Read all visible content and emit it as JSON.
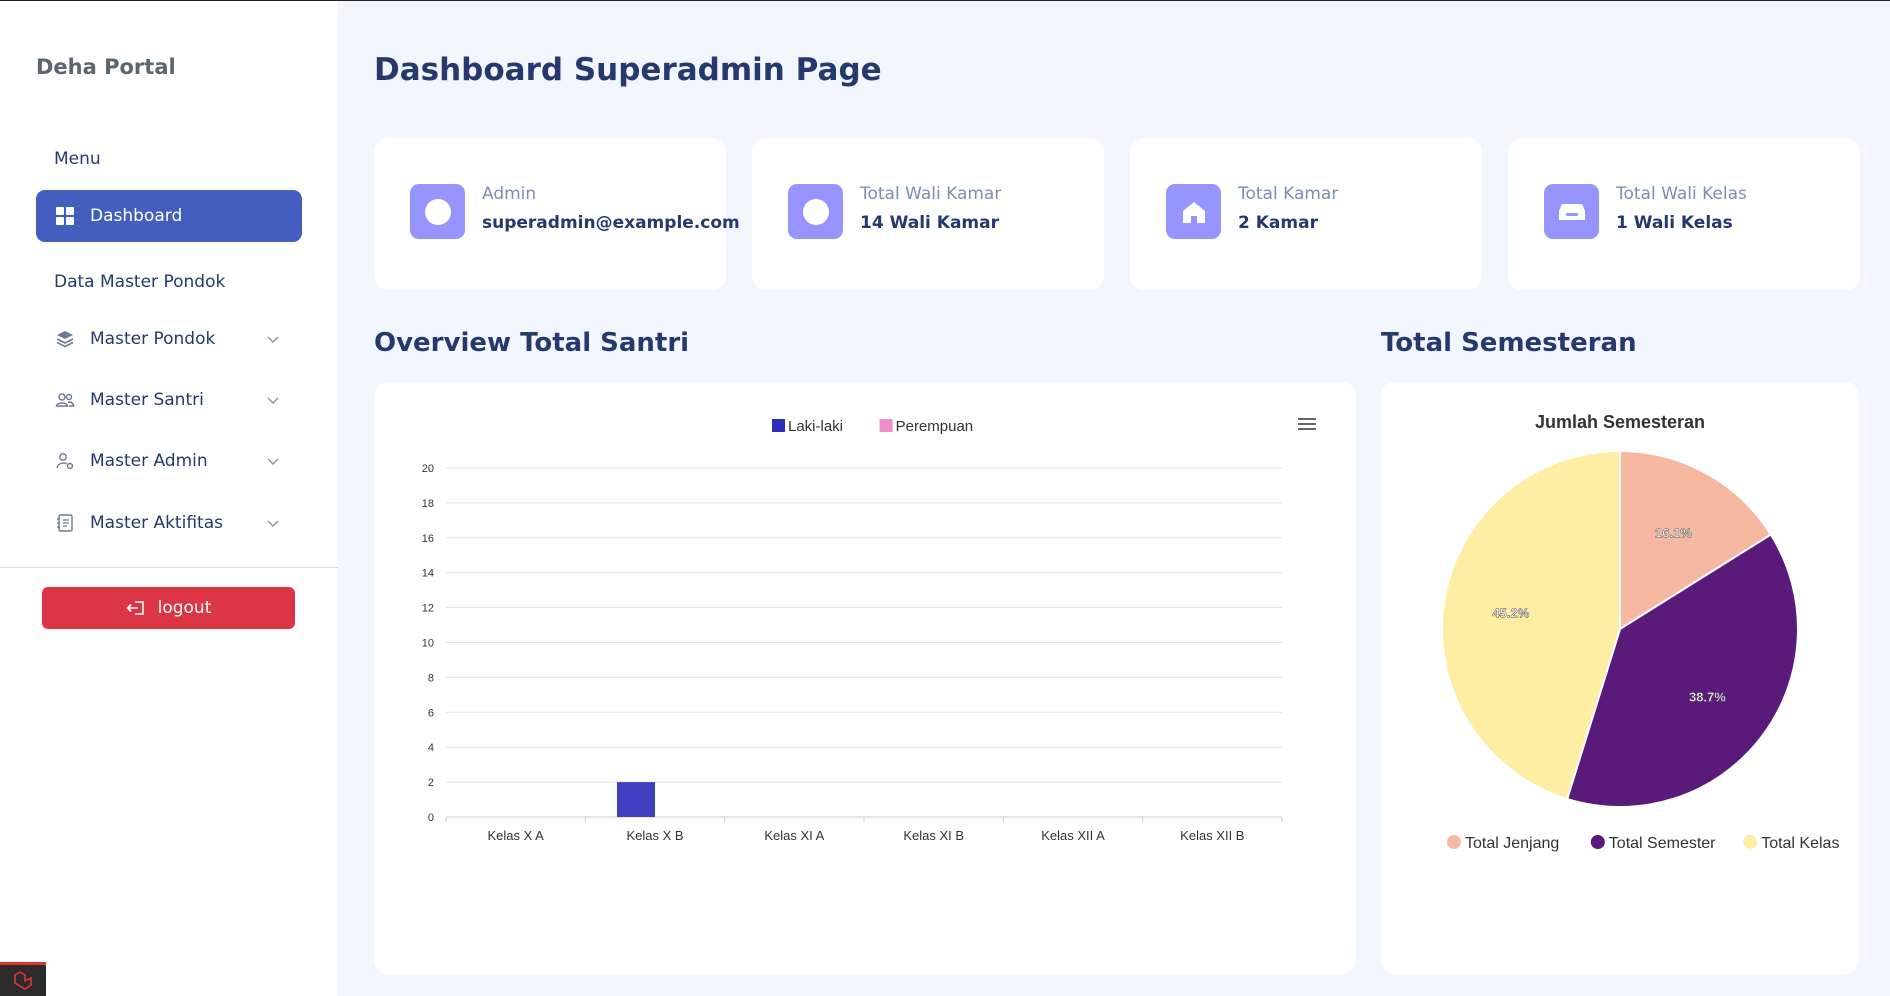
{
  "sidebar": {
    "brand": "Deha Portal",
    "menu_title": "Menu",
    "active_item": "Dashboard",
    "section_title": "Data Master Pondok",
    "items": [
      {
        "label": "Master Pondok",
        "icon": "layers-icon"
      },
      {
        "label": "Master Santri",
        "icon": "users-icon"
      },
      {
        "label": "Master Admin",
        "icon": "user-gear-icon"
      },
      {
        "label": "Master Aktifitas",
        "icon": "journal-icon"
      }
    ],
    "logout_label": "logout"
  },
  "main": {
    "title": "Dashboard Superadmin Page",
    "stats": [
      {
        "label": "Admin",
        "value": "superadmin@example.com",
        "icon": "circle-icon"
      },
      {
        "label": "Total Wali Kamar",
        "value": "14 Wali Kamar",
        "icon": "circle-icon"
      },
      {
        "label": "Total Kamar",
        "value": "2 Kamar",
        "icon": "house-icon"
      },
      {
        "label": "Total Wali Kelas",
        "value": "1 Wali Kelas",
        "icon": "inbox-icon"
      }
    ],
    "overview_title": "Overview Total Santri",
    "semester_title": "Total Semesteran"
  },
  "colors": {
    "accent": "#435ebe",
    "danger": "#dc3545",
    "icon_bg": "#9694ff",
    "laki": "#2e2eb8",
    "perempuan": "#f08cc8",
    "jenjang": "#f7b8a2",
    "semester": "#5a1a7a",
    "kelas": "#fdeea4"
  },
  "chart_data": [
    {
      "type": "bar",
      "categories": [
        "Kelas X A",
        "Kelas X B",
        "Kelas XI A",
        "Kelas XI B",
        "Kelas XII A",
        "Kelas XII B"
      ],
      "series": [
        {
          "name": "Laki-laki",
          "values": [
            0,
            2,
            0,
            0,
            0,
            0
          ]
        },
        {
          "name": "Perempuan",
          "values": [
            0,
            0,
            0,
            0,
            0,
            0
          ]
        }
      ],
      "ylim": [
        0,
        20
      ],
      "yticks": [
        0,
        2,
        4,
        6,
        8,
        10,
        12,
        14,
        16,
        18,
        20
      ],
      "legend": "top"
    },
    {
      "type": "pie",
      "title": "Jumlah Semesteran",
      "labels": [
        "Total Jenjang",
        "Total Semester",
        "Total Kelas"
      ],
      "values": [
        16.1,
        38.7,
        45.2
      ],
      "data_labels": [
        "16.1%",
        "38.7%",
        "45.2%"
      ],
      "legend": "bottom"
    }
  ]
}
